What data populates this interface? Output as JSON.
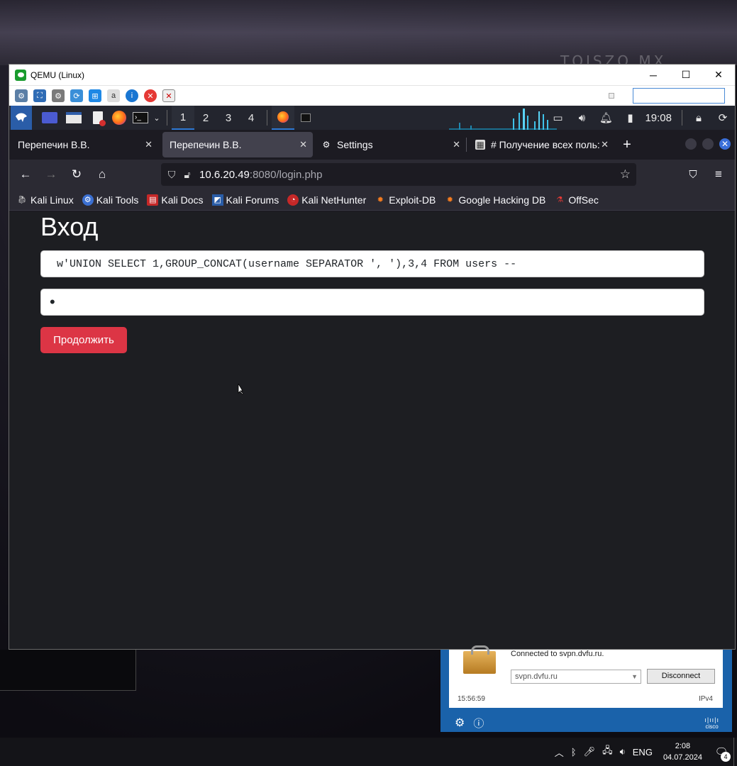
{
  "qemu": {
    "title": "QEMU (Linux)",
    "minimize": "─",
    "maximize": "☐",
    "close": "✕"
  },
  "kali_panel": {
    "workspaces": [
      "1",
      "2",
      "3",
      "4"
    ],
    "clock": "19:08"
  },
  "firefox": {
    "tabs": [
      {
        "label": "Перепечин В.В.",
        "active": false
      },
      {
        "label": "Перепечин В.В.",
        "active": true
      },
      {
        "label": "Settings",
        "active": false
      },
      {
        "label": "# Получение всех поль:",
        "active": false
      }
    ],
    "new_tab": "+",
    "url_host": "10.6.20.49",
    "url_path": ":8080/login.php",
    "bookmarks": [
      {
        "label": "Kali Linux",
        "icon": "kali-dragon-icon"
      },
      {
        "label": "Kali Tools",
        "icon": "kali-tools-icon"
      },
      {
        "label": "Kali Docs",
        "icon": "kali-docs-icon"
      },
      {
        "label": "Kali Forums",
        "icon": "kali-forums-icon"
      },
      {
        "label": "Kali NetHunter",
        "icon": "nethunter-icon"
      },
      {
        "label": "Exploit-DB",
        "icon": "exploitdb-icon"
      },
      {
        "label": "Google Hacking DB",
        "icon": "ghdb-icon"
      },
      {
        "label": "OffSec",
        "icon": "offsec-icon"
      }
    ]
  },
  "page": {
    "title": "Вход",
    "username_value": "w'UNION SELECT 1,GROUP_CONCAT(username SEPARATOR ', '),3,4 FROM users --",
    "password_value": "•",
    "submit_label": "Продолжить",
    "submit_color": "#dc3545"
  },
  "vpn": {
    "status": "Connected to svpn.dvfu.ru.",
    "server": "svpn.dvfu.ru",
    "disconnect_label": "Disconnect",
    "time": "15:56:59",
    "ip_version": "IPv4",
    "brand": "cisco"
  },
  "taskbar": {
    "language": "ENG",
    "time": "2:08",
    "date": "04.07.2024",
    "notification_count": "4"
  }
}
